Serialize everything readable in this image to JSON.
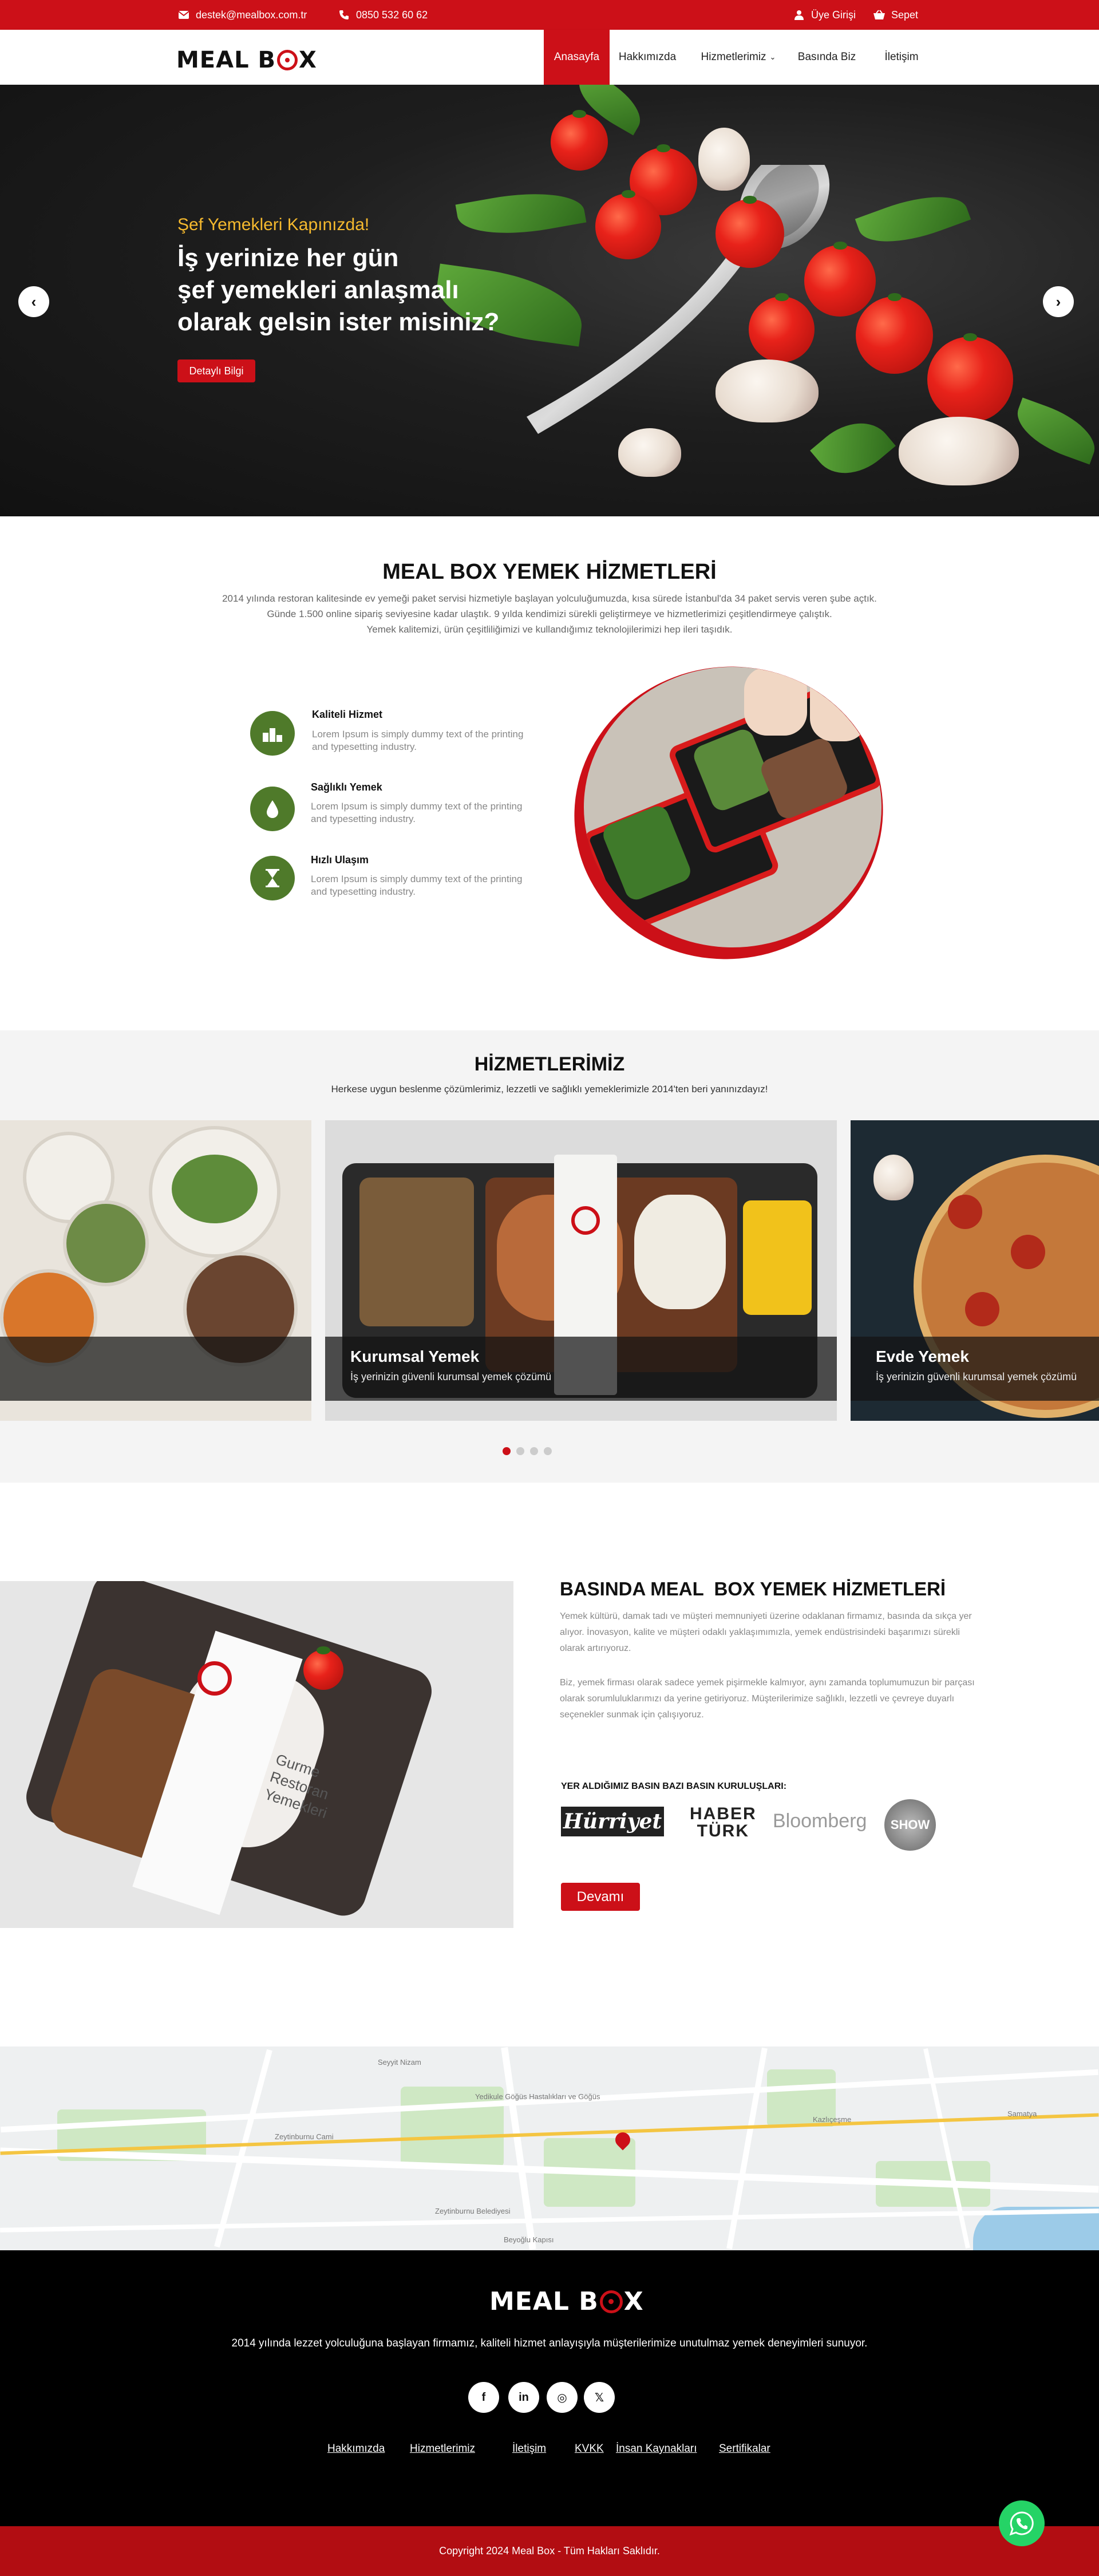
{
  "topbar": {
    "email": "destek@mealbox.com.tr",
    "phone": "0850 532 60 62",
    "login": "Üye Girişi",
    "cart": "Sepet"
  },
  "brand": {
    "logo_text_a": "MEAL B",
    "logo_text_b": "X"
  },
  "nav": {
    "items": [
      "Anasayfa",
      "Hakkımızda",
      "Hizmetlerimiz",
      "Basında Biz",
      "İletişim"
    ],
    "dropdown_icon": "chevron-down-icon"
  },
  "hero": {
    "subtitle": "Şef Yemekleri Kapınızda!",
    "title_line1": "İş yerinize her gün",
    "title_line2": "şef yemekleri anlaşmalı",
    "title_line3": "olarak gelsin ister misiniz?",
    "button": "Detaylı Bilgi",
    "prev_icon": "chevron-left-icon",
    "next_icon": "chevron-right-icon"
  },
  "about": {
    "title": "MEAL BOX YEMEK HİZMETLERİ",
    "p1": "2014 yılında restoran kalitesinde ev yemeği paket servisi hizmetiyle başlayan yolculuğumuzda, kısa sürede İstanbul'da 34 paket servis veren şube açtık.",
    "p2": "Günde 1.500 online sipariş seviyesine kadar ulaştık. 9 yılda kendimizi sürekli geliştirmeye ve hizmetlerimizi çeşitlendirmeye çalıştık.",
    "p3": "Yemek kalitemizi, ürün çeşitliliğimizi ve kullandığımız teknolojilerimizi hep ileri taşıdık.",
    "features": [
      {
        "title": "Kaliteli Hizmet",
        "desc": "Lorem Ipsum is simply dummy text of the printing and typesetting industry.",
        "icon": "podium-icon"
      },
      {
        "title": "Sağlıklı Yemek",
        "desc": "Lorem Ipsum is simply dummy text of the printing and typesetting industry.",
        "icon": "drop-icon"
      },
      {
        "title": "Hızlı Ulaşım",
        "desc": "Lorem Ipsum is simply dummy text of the printing and typesetting industry.",
        "icon": "hourglass-icon"
      }
    ]
  },
  "services": {
    "title": "HİZMETLERİMİZ",
    "subtitle": "Herkese uygun beslenme çözümlerimiz, lezzetli ve sağlıklı yemeklerimizle 2014'ten beri yanınızdayız!",
    "cards": [
      {
        "title": "Kurumsal Yemek",
        "desc": "İş yerinizin güvenli kurumsal yemek çözümü"
      },
      {
        "title": "Evde Yemek",
        "desc": "İş yerinizin güvenli kurumsal yemek çözümü"
      }
    ]
  },
  "press": {
    "title": "BASINDA MEAL  BOX YEMEK HİZMETLERİ",
    "p1": "Yemek kültürü, damak tadı ve müşteri memnuniyeti üzerine odaklanan firmamız, basında da sıkça yer alıyor. İnovasyon, kalite ve müşteri odaklı yaklaşımımızla, yemek endüstrisindeki başarımızı sürekli olarak artırıyoruz.",
    "p2": "Biz, yemek firması olarak sadece yemek pişirmekle kalmıyor, aynı zamanda toplumumuzun bir parçası olarak sorumluluklarımızı da yerine getiriyoruz. Müşterilerimize sağlıklı, lezzetli ve çevreye duyarlı seçenekler sunmak için çalışıyoruz.",
    "outlets_title": "YER ALDIĞIMIZ BASIN BAZI BASIN KURULUŞLARI:",
    "outlets": [
      "Hürriyet",
      "HABER",
      "TÜRK",
      "Bloomberg",
      "SHOW"
    ],
    "button": "Devamı",
    "pack_text": [
      "Gurme",
      "Restoran",
      "Yemekleri"
    ]
  },
  "map": {
    "labels": [
      "Yedikule Göğüs Hastalıkları ve Göğüs",
      "Zeytinburnu Belediyesi",
      "Beyoğlu Kapısı",
      "Seyyit Nizam",
      "Zeytinburnu Cami",
      "Kazlıçeşme",
      "Samatya"
    ]
  },
  "footer": {
    "text": "2014 yılında lezzet yolculuğuna başlayan firmamız, kaliteli hizmet anlayışıyla müşterilerimize unutulmaz yemek deneyimleri sunuyor.",
    "social": [
      "f",
      "in",
      "◎",
      "𝕏"
    ],
    "links": [
      "Hakkımızda",
      "Hizmetlerimiz",
      "İletişim",
      "KVKK",
      "İnsan Kaynakları",
      "Sertifikalar"
    ],
    "copyright": "Copyright 2024 Meal Box - Tüm Hakları Saklıdır."
  },
  "colors": {
    "brand_red": "#cc1018",
    "feature_green": "#4f7a2a",
    "whatsapp": "#25d366"
  }
}
